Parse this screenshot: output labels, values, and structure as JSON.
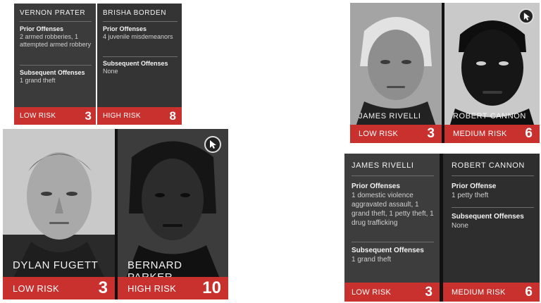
{
  "panel_tl": {
    "left": {
      "name": "VERNON PRATER",
      "prior_label": "Prior Offenses",
      "prior_value": "2 armed robberies, 1 attempted armed robbery",
      "subsequent_label": "Subsequent Offenses",
      "subsequent_value": "1 grand theft",
      "risk_label": "LOW RISK",
      "score": "3"
    },
    "right": {
      "name": "BRISHA BORDEN",
      "prior_label": "Prior Offenses",
      "prior_value": "4 juvenile misdemeanors",
      "subsequent_label": "Subsequent Offenses",
      "subsequent_value": "None",
      "risk_label": "HIGH RISK",
      "score": "8"
    }
  },
  "panel_bl": {
    "left": {
      "name": "DYLAN FUGETT",
      "risk_label": "LOW RISK",
      "score": "3"
    },
    "right": {
      "name": "BERNARD PARKER",
      "risk_label": "HIGH RISK",
      "score": "10"
    }
  },
  "panel_tr": {
    "left": {
      "name": "JAMES RIVELLI",
      "risk_label": "LOW RISK",
      "score": "3"
    },
    "right": {
      "name": "ROBERT CANNON",
      "risk_label": "MEDIUM RISK",
      "score": "6"
    }
  },
  "panel_br": {
    "left": {
      "name": "JAMES RIVELLI",
      "prior_label": "Prior Offenses",
      "prior_value": "1 domestic violence aggravated assault, 1 grand theft, 1 petty theft, 1 drug trafficking",
      "subsequent_label": "Subsequent Offenses",
      "subsequent_value": "1 grand theft",
      "risk_label": "LOW RISK",
      "score": "3"
    },
    "right": {
      "name": "ROBERT CANNON",
      "prior_label": "Prior Offense",
      "prior_value": "1 petty theft",
      "subsequent_label": "Subsequent Offenses",
      "subsequent_value": "None",
      "risk_label": "MEDIUM RISK",
      "score": "6"
    }
  },
  "icons": {
    "cursor": "pointer-cursor-icon"
  },
  "colors": {
    "risk_bar": "#c8312e",
    "card_bg": "#3a3a3a",
    "photo_bg": "#1c1c1c"
  }
}
